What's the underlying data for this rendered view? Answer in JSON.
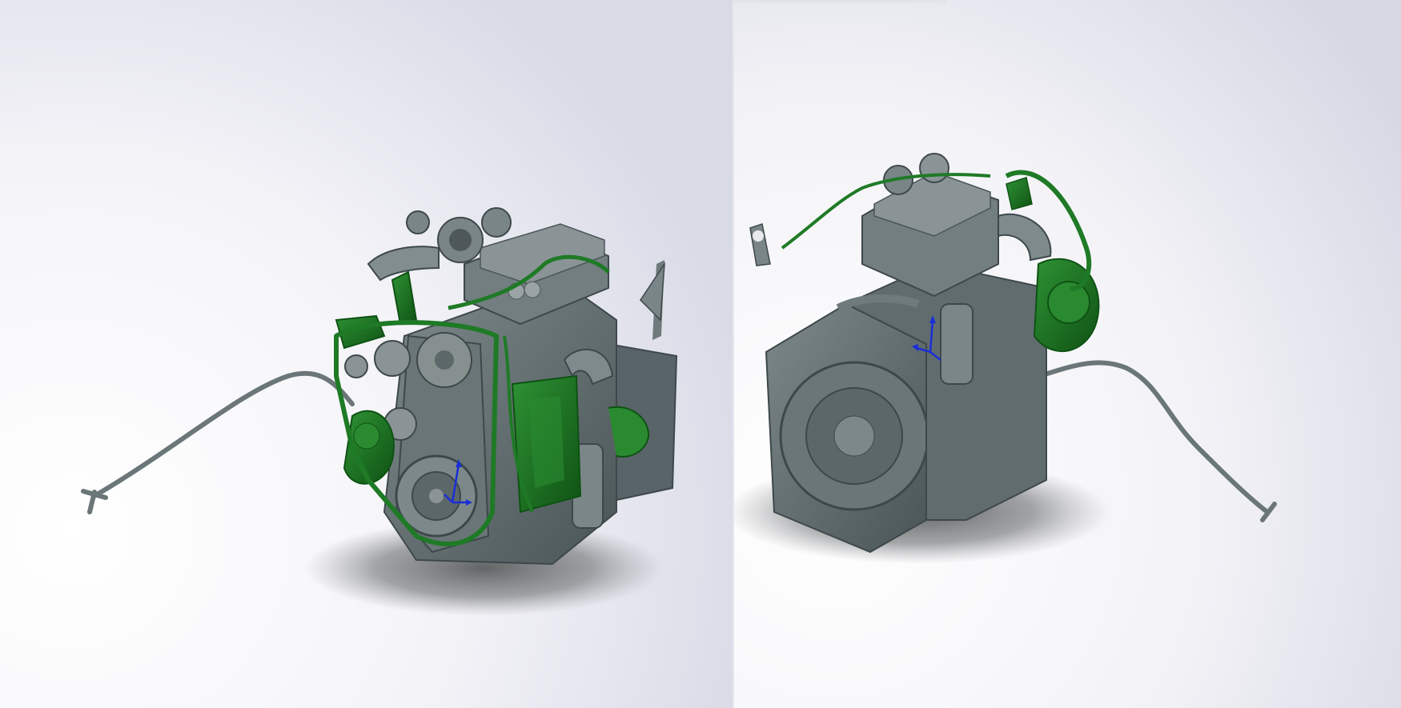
{
  "scene": {
    "viewports": [
      {
        "name": "left-view",
        "model": "engine-front-quarter-view",
        "triad_icon": "axis-triad-icon"
      },
      {
        "name": "right-view",
        "model": "engine-rear-quarter-view",
        "triad_icon": "axis-triad-icon"
      }
    ],
    "colors": {
      "background_top": "#dcdee8",
      "background_bottom": "#ffffff",
      "engine_gray": "#5f6b6f",
      "engine_gray_dark": "#3e484b",
      "engine_gray_light": "#8a9496",
      "highlight_green": "#1f7a26",
      "highlight_green_dark": "#0f5214",
      "triad_blue": "#1a2fd6",
      "shadow": "#6e7072"
    }
  }
}
